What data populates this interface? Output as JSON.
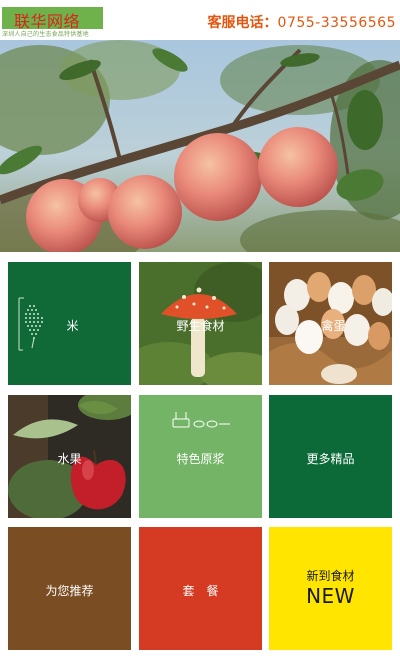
{
  "header": {
    "logo_text": "联华网络",
    "logo_sub": "深圳人自己的生态食品特供基地",
    "hotline_label": "客服电话：",
    "hotline_number": "0755-33556565"
  },
  "tiles": [
    {
      "label": "米",
      "bg": "#0f6a38"
    },
    {
      "label": "野生食材",
      "bg": "#4a7a2c"
    },
    {
      "label": "禽蛋",
      "bg": "#8a5a2e"
    },
    {
      "label": "水果",
      "bg": "#2e2a24"
    },
    {
      "label": "特色原浆",
      "bg": "#74b466"
    },
    {
      "label": "更多精品",
      "bg": "#0b6a38"
    },
    {
      "label": "为您推荐",
      "bg": "#7a4d22"
    },
    {
      "label": "套　餐",
      "bg": "#d53a22"
    },
    {
      "label": "新到食材",
      "sub": "NEW",
      "bg": "#ffe500"
    }
  ],
  "colors": {
    "hotline": "#e4550f",
    "logo_bg": "#6fb14a",
    "logo_text": "#d7261c"
  },
  "icons": {
    "tile_rice": "rice-stalk-icon",
    "tile_special": "pulp-drink-icon"
  }
}
